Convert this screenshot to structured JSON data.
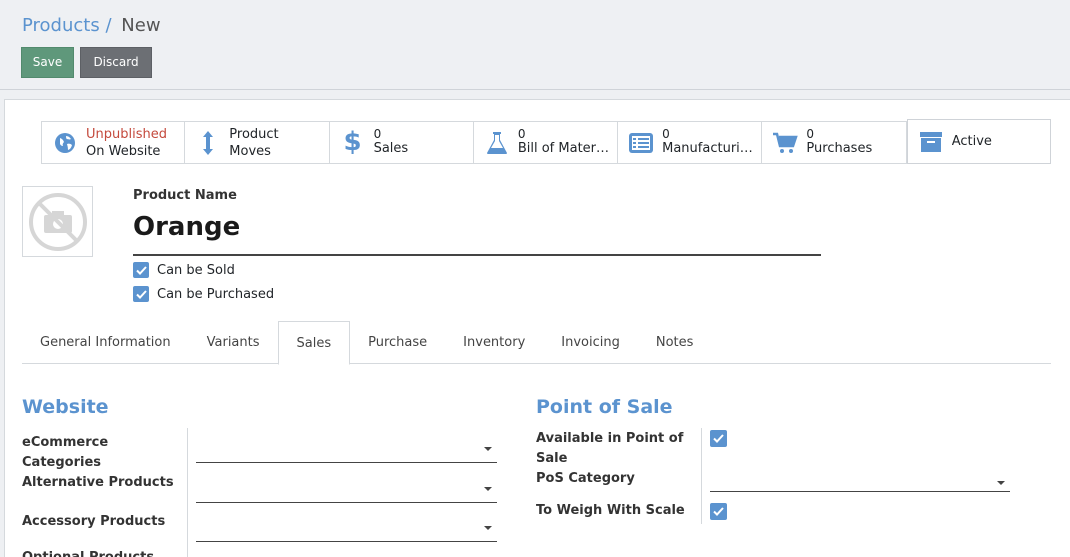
{
  "breadcrumb": {
    "parent": "Products",
    "separator": "/",
    "current": "New"
  },
  "actions": {
    "save": "Save",
    "discard": "Discard"
  },
  "stat_buttons": [
    {
      "line1": "Unpublished",
      "line2": "On Website",
      "icon": "globe-icon"
    },
    {
      "line1": "Product",
      "line2": "Moves",
      "icon": "arrows-vertical-icon"
    },
    {
      "line1": "0",
      "line2": "Sales",
      "icon": "dollar-icon"
    },
    {
      "line1": "0",
      "line2": "Bill of Mater…",
      "icon": "flask-icon"
    },
    {
      "line1": "0",
      "line2": "Manufacturi…",
      "icon": "list-icon"
    },
    {
      "line1": "0",
      "line2": "Purchases",
      "icon": "cart-icon"
    },
    {
      "line1": "Active",
      "icon": "archive-icon"
    }
  ],
  "product": {
    "name_label": "Product Name",
    "name": "Orange",
    "can_be_sold": "Can be Sold",
    "can_be_purchased": "Can be Purchased"
  },
  "tabs": [
    "General Information",
    "Variants",
    "Sales",
    "Purchase",
    "Inventory",
    "Invoicing",
    "Notes"
  ],
  "active_tab": "Sales",
  "website": {
    "title": "Website",
    "ecommerce_1": "eCommerce",
    "ecommerce_2": "Categories",
    "alternative": "Alternative Products",
    "accessory": "Accessory Products",
    "optional": "Optional Products"
  },
  "pos": {
    "title": "Point of Sale",
    "available_1": "Available in Point of",
    "available_2": "Sale",
    "category": "PoS Category",
    "weigh": "To Weigh With Scale"
  },
  "colors": {
    "accent": "#5b93cf",
    "save": "#5f987b",
    "discard": "#6c6f74",
    "unpublished": "#c44a3d"
  }
}
